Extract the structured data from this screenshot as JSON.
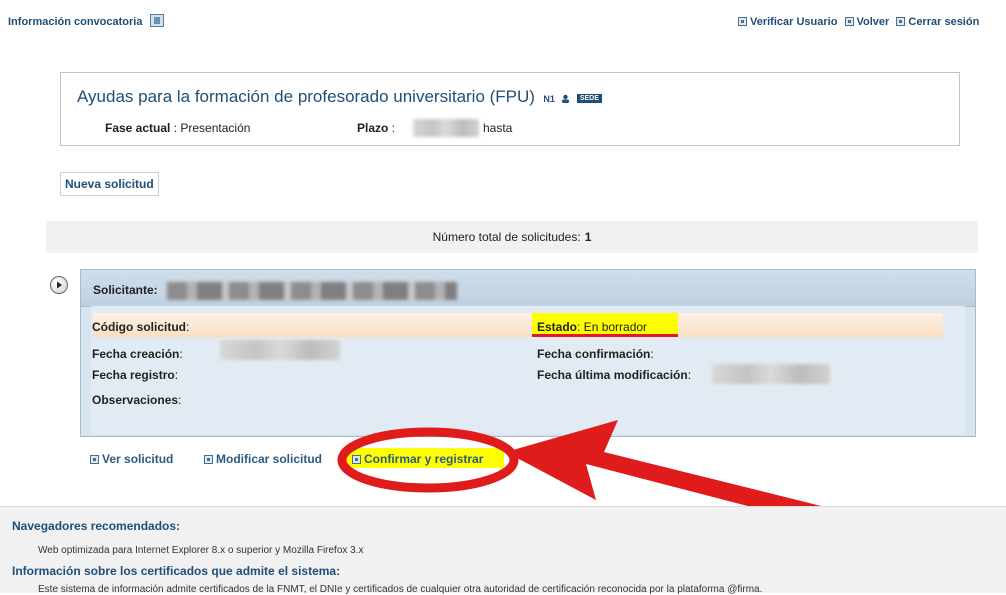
{
  "header": {
    "info_link": "Información convocatoria",
    "nav": [
      {
        "label": "Verificar Usuario"
      },
      {
        "label": "Volver"
      },
      {
        "label": "Cerrar sesión"
      }
    ]
  },
  "convocatoria": {
    "title": "Ayudas para la formación de profesorado universitario (FPU)",
    "level_badge": "N1",
    "sede_badge": "SEDE",
    "fase_label": "Fase actual",
    "fase_value": ": Presentación",
    "plazo_label": "Plazo",
    "plazo_sep": ":",
    "hasta": "hasta"
  },
  "new_request_button": "Nueva solicitud",
  "total": {
    "label": "Número total de solicitudes:",
    "count": "1"
  },
  "solicitud": {
    "solicitante_label": "Solicitante:",
    "codigo_label": "Código solicitud",
    "codigo_sep": ":",
    "estado_label": "Estado",
    "estado_value": ":  En borrador",
    "fecha_creacion_label": "Fecha creación",
    "fecha_creacion_sep": ":",
    "fecha_confirmacion_label": "Fecha confirmación",
    "fecha_confirmacion_sep": ":",
    "fecha_registro_label": "Fecha registro",
    "fecha_registro_sep": ":",
    "fecha_mod_label": "Fecha última modificación",
    "fecha_mod_sep": ":",
    "observaciones_label": "Observaciones",
    "observaciones_sep": ":"
  },
  "actions": {
    "ver": "Ver solicitud",
    "modificar": "Modificar solicitud",
    "confirmar": "Confirmar y registrar"
  },
  "footer": {
    "nav_title": "Navegadores recomendados:",
    "nav_text": "Web optimizada para Internet Explorer 8.x o superior y Mozilla Firefox 3.x",
    "cert_title": "Información sobre los certificados que admite el sistema:",
    "cert_text": "Este sistema de información admite certificados de la FNMT, el DNIe y certificados de cualquier otra autoridad de certificación reconocida por la plataforma @firma."
  },
  "colors": {
    "highlight": "#ffff00",
    "annotation_red": "#e01b1b",
    "panel_blue": "#d4e2ee",
    "row_peach": "#fbe7d0"
  }
}
